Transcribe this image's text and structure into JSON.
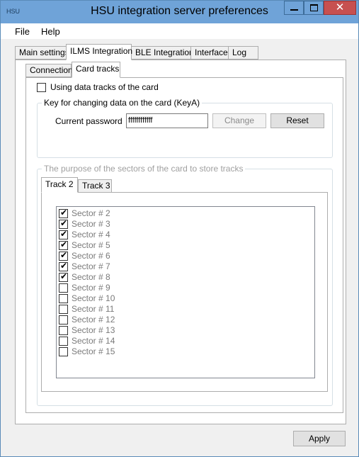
{
  "window": {
    "app_icon_text": "HSU",
    "title": "HSU integration server preferences",
    "close_glyph": "✕"
  },
  "menu": [
    {
      "label": "File"
    },
    {
      "label": "Help"
    }
  ],
  "main_tabs": [
    {
      "label": "Main settings",
      "active": false
    },
    {
      "label": "ILMS Integration",
      "active": true
    },
    {
      "label": "BLE Integration",
      "active": false
    },
    {
      "label": "Interface",
      "active": false
    },
    {
      "label": "Log",
      "active": false
    }
  ],
  "sub_tabs": [
    {
      "label": "Connection",
      "active": false
    },
    {
      "label": "Card tracks",
      "active": true
    }
  ],
  "card_tracks": {
    "use_tracks_label": "Using data tracks of the card",
    "use_tracks_checked": false,
    "key_group_title": "Key for changing data on the card (KeyA)",
    "password_label": "Current password",
    "password_value": "ffffffffffff",
    "change_button": "Change",
    "reset_button": "Reset",
    "sectors_group_title": "The purpose of the sectors of the card to store tracks",
    "track_tabs": [
      {
        "label": "Track 2",
        "active": true
      },
      {
        "label": "Track 3",
        "active": false
      }
    ],
    "sectors": [
      {
        "label": "Sector # 2",
        "checked": true
      },
      {
        "label": "Sector # 3",
        "checked": true
      },
      {
        "label": "Sector # 4",
        "checked": true
      },
      {
        "label": "Sector # 5",
        "checked": true
      },
      {
        "label": "Sector # 6",
        "checked": true
      },
      {
        "label": "Sector # 7",
        "checked": true
      },
      {
        "label": "Sector # 8",
        "checked": true
      },
      {
        "label": "Sector # 9",
        "checked": false
      },
      {
        "label": "Sector # 10",
        "checked": false
      },
      {
        "label": "Sector # 11",
        "checked": false
      },
      {
        "label": "Sector # 12",
        "checked": false
      },
      {
        "label": "Sector # 13",
        "checked": false
      },
      {
        "label": "Sector # 14",
        "checked": false
      },
      {
        "label": "Sector # 15",
        "checked": false
      }
    ]
  },
  "apply_button": "Apply"
}
